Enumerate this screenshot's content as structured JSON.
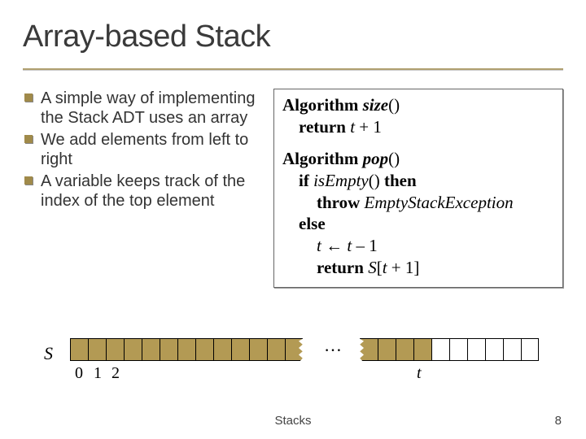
{
  "title": "Array-based Stack",
  "bullets": [
    "A simple way of implementing the Stack ADT uses an array",
    "We add elements from left to right",
    "A variable keeps track of the  index of the top element"
  ],
  "algo": {
    "kw_algorithm1": "Algorithm",
    "fn_size": "size",
    "parens1": "()",
    "kw_return1": "return",
    "size_expr_var": "t",
    "size_expr_rest": " + 1",
    "kw_algorithm2": "Algorithm",
    "fn_pop": "pop",
    "parens2": "()",
    "kw_if": "if",
    "cond_fn": "isEmpty",
    "cond_rest": "()",
    "kw_then": "then",
    "kw_throw": "throw",
    "exception": "EmptyStackException",
    "kw_else": "else",
    "assign_lhs": "t",
    "assign_arrow": " ← ",
    "assign_rhs_var": "t",
    "assign_rhs_rest": " – 1",
    "kw_return2": "return",
    "ret_arr": "S",
    "ret_open": "[",
    "ret_var": "t",
    "ret_rest": " + 1]"
  },
  "diagram": {
    "s_label": "S",
    "dots": "…",
    "idx0": "0",
    "idx1": "1",
    "idx2": "2",
    "t_label": "t"
  },
  "footer": {
    "center": "Stacks",
    "page": "8"
  }
}
